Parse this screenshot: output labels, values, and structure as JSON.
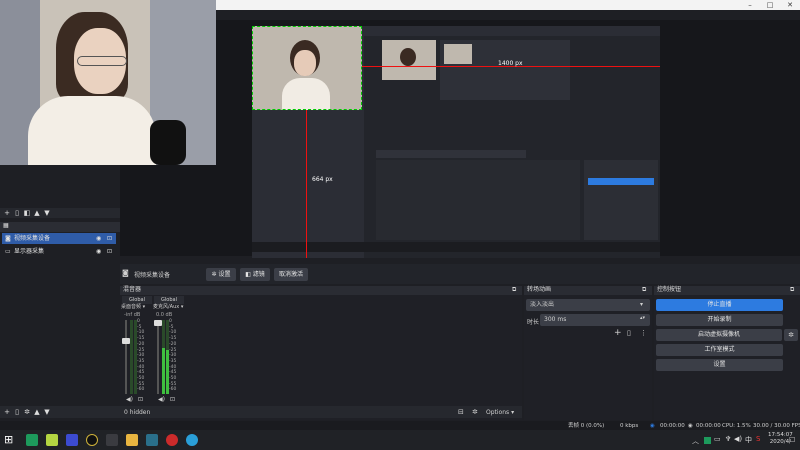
{
  "window": {
    "minimize": "–",
    "maximize": "□",
    "close": "✕"
  },
  "preview": {
    "size_label": "1400 px",
    "side_label": "664 px"
  },
  "source_bar": {
    "source_name": "视频采集设备",
    "properties": "设置",
    "filters": "滤镜",
    "deactivate": "取消激活"
  },
  "sources": {
    "items": [
      {
        "label": "视频采集设备",
        "selected": true
      },
      {
        "label": "显示器采集",
        "selected": false
      }
    ]
  },
  "mixer": {
    "title": "混音器",
    "channels": [
      {
        "badge": "Global",
        "name": "桌面音频",
        "db": "-inf dB"
      },
      {
        "badge": "Global",
        "name": "麦克风/Aux",
        "db": "0.0 dB"
      }
    ],
    "scale": [
      "0",
      "-5",
      "-10",
      "-15",
      "-20",
      "-25",
      "-30",
      "-35",
      "-40",
      "-45",
      "-50",
      "-55",
      "-60"
    ],
    "hidden": "0 hidden",
    "options": "Options"
  },
  "transitions": {
    "title": "转场动画",
    "type": "淡入淡出",
    "duration_label": "时长",
    "duration_value": "300 ms"
  },
  "controls": {
    "title": "控制按钮",
    "stop_streaming": "停止直播",
    "start_recording": "开始录制",
    "virtual_camera": "启动虚拟摄像机",
    "studio_mode": "工作室模式",
    "settings": "设置"
  },
  "status": {
    "dropped": "丢帧 0 (0.0%)",
    "bitrate": "0 kbps",
    "stream_time": "00:00:00",
    "rec_time": "00:00:00",
    "cpu": "CPU: 1.5%",
    "fps": "30.00 / 30.00 FPS"
  },
  "clock": {
    "time": "17:54:07",
    "date": "2020/4/"
  },
  "tray": {
    "ime": "中",
    "lang": "S"
  },
  "colors": {
    "accent": "#2d7be0",
    "selected": "#2f5ca8",
    "guide": "#e11111",
    "bounds": "#00cc00"
  }
}
